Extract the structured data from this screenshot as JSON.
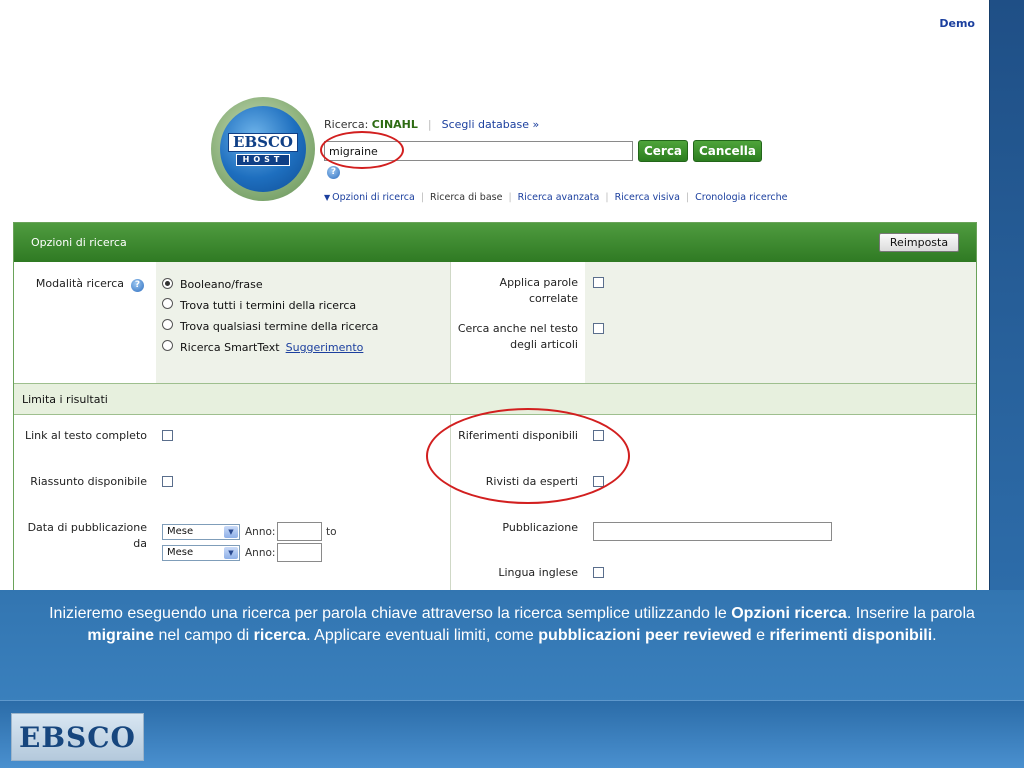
{
  "header": {
    "demo_link": "Demo"
  },
  "logo": {
    "word": "EBSCO",
    "sub": "HOST"
  },
  "search": {
    "label_prefix": "Ricerca:",
    "database": "CINAHL",
    "choose_db": "Scegli database »",
    "query_value": "migraine",
    "search_button": "Cerca",
    "clear_button": "Cancella",
    "help_glyph": "?"
  },
  "nav": {
    "links": [
      "Opzioni di ricerca",
      "Ricerca di base",
      "Ricerca avanzata",
      "Ricerca visiva",
      "Cronologia ricerche"
    ]
  },
  "options": {
    "title": "Opzioni di ricerca",
    "reset_button": "Reimposta",
    "mode_label": "Modalità ricerca",
    "modes": [
      "Booleano/frase",
      "Trova tutti i termini della ricerca",
      "Trova qualsiasi termine della ricerca",
      "Ricerca SmartText"
    ],
    "selected_mode": 0,
    "suggest_link": "Suggerimento",
    "apply_related_line1": "Applica parole",
    "apply_related_line2": "correlate",
    "fulltext_search_line1": "Cerca anche nel testo",
    "fulltext_search_line2": "degli articoli"
  },
  "limits": {
    "title": "Limita i risultati",
    "full_text": "Link al testo completo",
    "references": "Riferimenti disponibili",
    "abstract": "Riassunto disponibile",
    "peer_reviewed": "Rivisti da esperti",
    "pub_date_line1": "Data di pubblicazione",
    "pub_date_line2": "da",
    "month_option": "Mese",
    "year_label": "Anno:",
    "to_label": "to",
    "publication": "Pubblicazione",
    "english": "Lingua inglese"
  },
  "caption": {
    "p1": "Inizieremo eseguendo una ricerca per parola chiave attraverso la ricerca semplice utilizzando le ",
    "b1": "Opzioni ricerca",
    "p2": ". Inserire la parola ",
    "b2": "migraine",
    "p3": " nel campo di ",
    "b3": "ricerca",
    "p4": ". Applicare eventuali limiti, come ",
    "b4": "pubblicazioni peer reviewed",
    "p5": " e ",
    "b5": "riferimenti disponibili",
    "p6": "."
  },
  "footer": {
    "logo_text": "EBSCO"
  },
  "colors": {
    "accent_green": "#2f7a23",
    "link_blue": "#1b3f9e",
    "annotation_red": "#d21f1f",
    "slide_blue": "#2f6fa8"
  }
}
